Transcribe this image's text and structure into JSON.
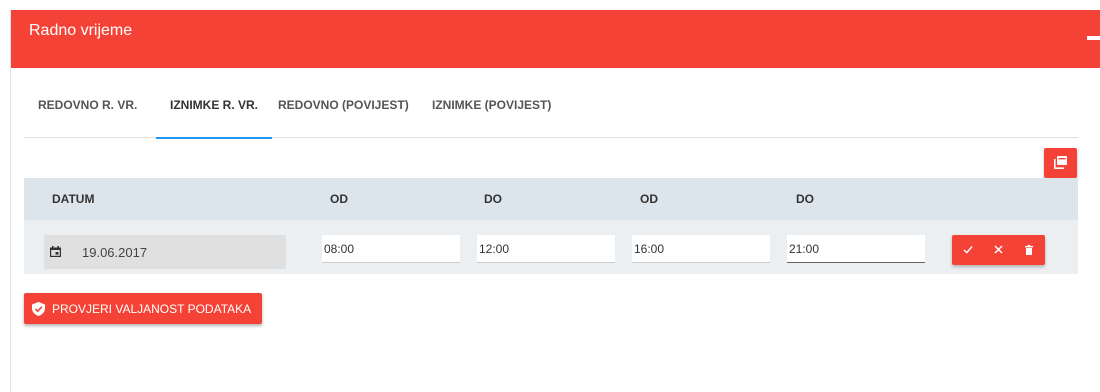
{
  "panel": {
    "title": "Radno vrijeme",
    "header_color": "#f44336"
  },
  "tabs": [
    {
      "label": "REDOVNO R. VR.",
      "active": false
    },
    {
      "label": "IZNIMKE R. VR.",
      "active": true
    },
    {
      "label": "REDOVNO (POVIJEST)",
      "active": false
    },
    {
      "label": "IZNIMKE (POVIJEST)",
      "active": false
    }
  ],
  "table": {
    "headers": [
      "DATUM",
      "OD",
      "DO",
      "OD",
      "DO"
    ],
    "row": {
      "date": "19.06.2017",
      "od1": "08:00",
      "do1": "12:00",
      "od2": "16:00",
      "do2": "21:00"
    }
  },
  "icons": {
    "copy": "copy-icon",
    "calendar": "calendar-icon",
    "confirm": "check-icon",
    "cancel": "close-icon",
    "delete": "trash-icon",
    "validate": "shield-check-icon",
    "collapse": "minus-icon"
  },
  "validate_button": {
    "label": "PROVJERI VALJANOST PODATAKA"
  },
  "colors": {
    "accent": "#f44336",
    "tab_indicator": "#2196f3",
    "table_header": "#dde5ec",
    "table_row": "#eceff1"
  }
}
